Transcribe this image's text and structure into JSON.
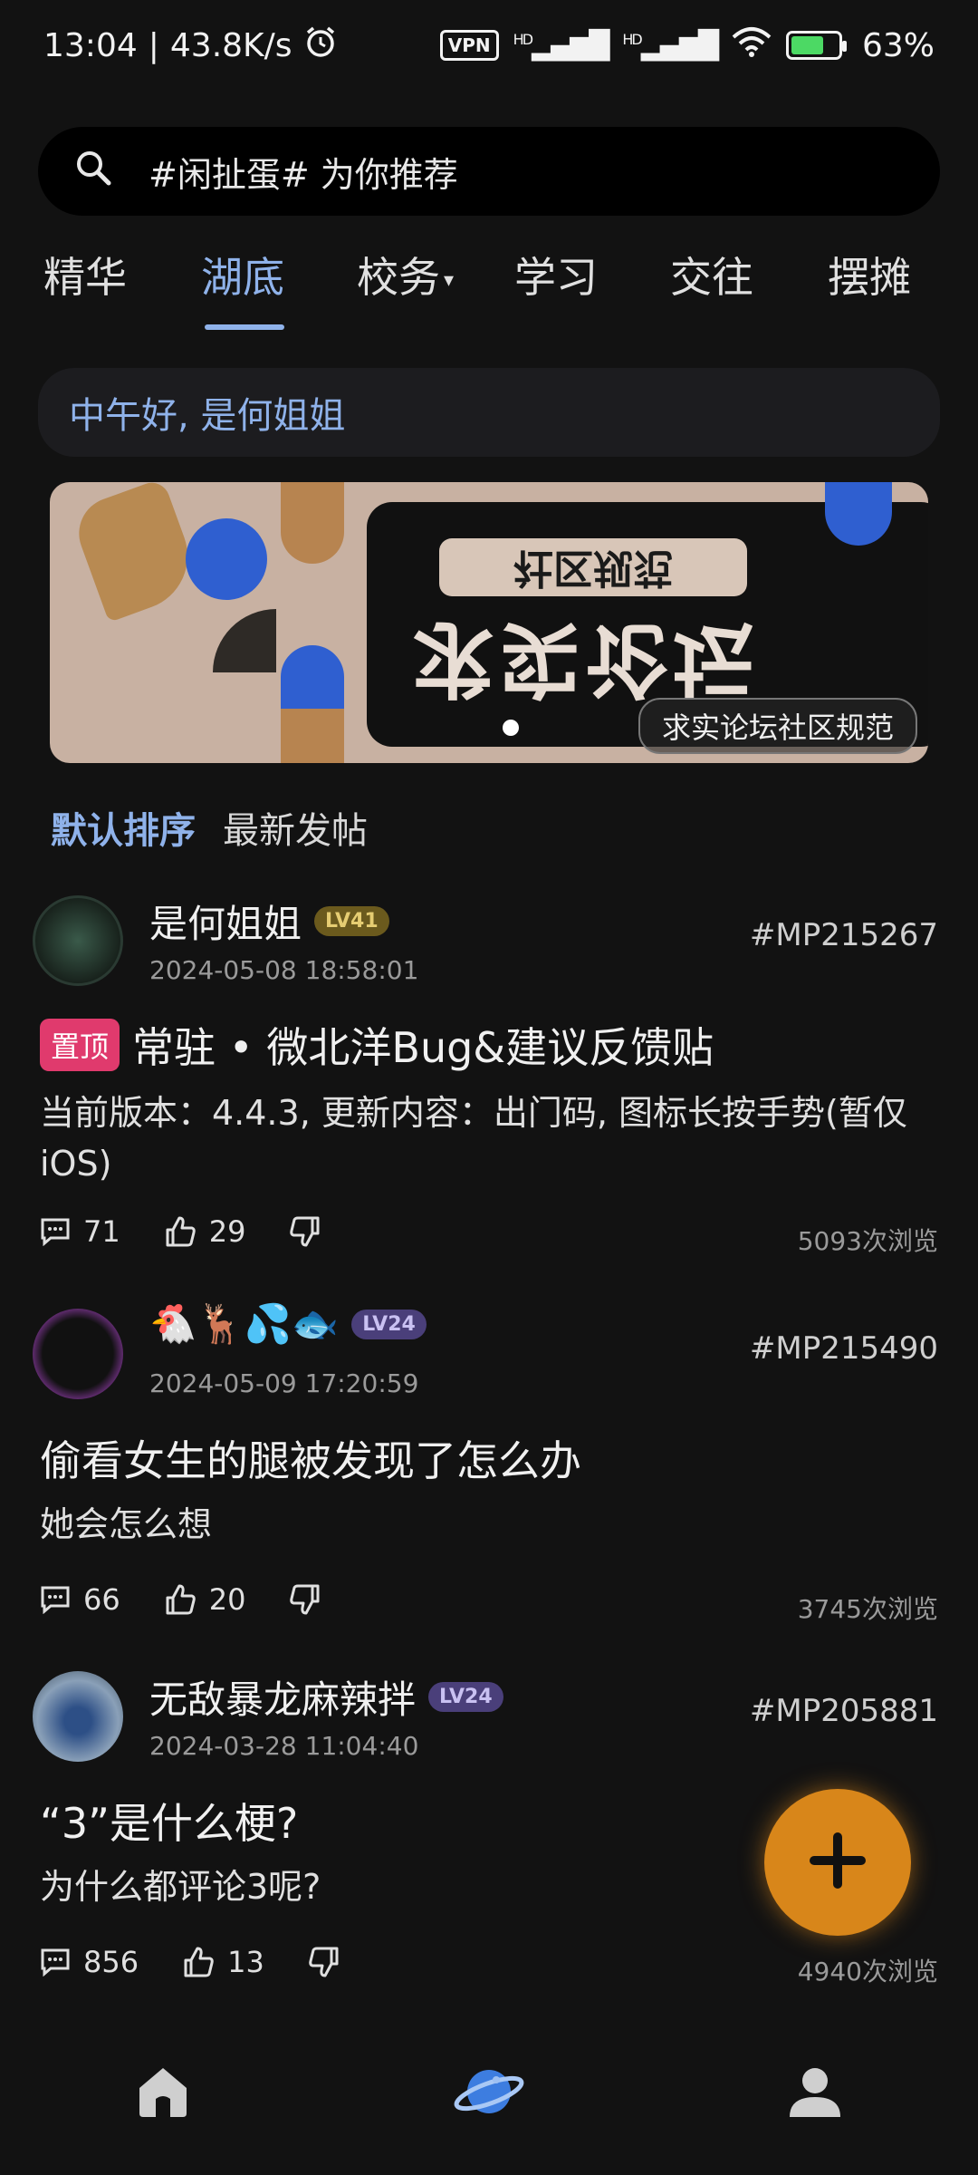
{
  "status_bar": {
    "time": "13:04",
    "speed": "43.8K/s",
    "vpn": "VPN",
    "signal1": "HD",
    "signal2": "HD",
    "battery": "63%"
  },
  "search": {
    "placeholder": "#闲扯蛋#  为你推荐"
  },
  "tabs": [
    {
      "label": "精华"
    },
    {
      "label": "湖底"
    },
    {
      "label": "校务"
    },
    {
      "label": "学习"
    },
    {
      "label": "交往"
    },
    {
      "label": "摆摊"
    }
  ],
  "greeting": "中午好, 是何姐姐",
  "banner": {
    "caption": "求实论坛社区规范",
    "title_text": "求实论坛",
    "sub_text": "社区规范"
  },
  "sort": {
    "default": "默认排序",
    "latest": "最新发帖"
  },
  "posts": [
    {
      "username": "是何姐姐",
      "level": "LV41",
      "date": "2024-05-08 18:58:01",
      "id": "#MP215267",
      "pin_label": "置顶",
      "title": "常驻 • 微北洋Bug&建议反馈贴",
      "body": "当前版本：4.4.3, 更新内容：出门码, 图标长按手势(暂仅iOS)",
      "comments": "71",
      "likes": "29",
      "views": "5093次浏览"
    },
    {
      "username": "🐔🦌💦🐟",
      "level": "LV24",
      "date": "2024-05-09 17:20:59",
      "id": "#MP215490",
      "title": "偷看女生的腿被发现了怎么办",
      "body": "她会怎么想",
      "comments": "66",
      "likes": "20",
      "views": "3745次浏览"
    },
    {
      "username": "无敌暴龙麻辣拌",
      "level": "LV24",
      "date": "2024-03-28 11:04:40",
      "id": "#MP205881",
      "title": "“3”是什么梗?",
      "body": "为什么都评论3呢?",
      "comments": "856",
      "likes": "13",
      "views": "4940次浏览"
    }
  ],
  "colors": {
    "accent": "#8fb2ea",
    "fab": "#d8861a",
    "pin": "#e03a6d",
    "background": "#121212"
  },
  "icons": {
    "home": "home-icon",
    "discover": "planet-icon",
    "profile": "user-icon"
  }
}
